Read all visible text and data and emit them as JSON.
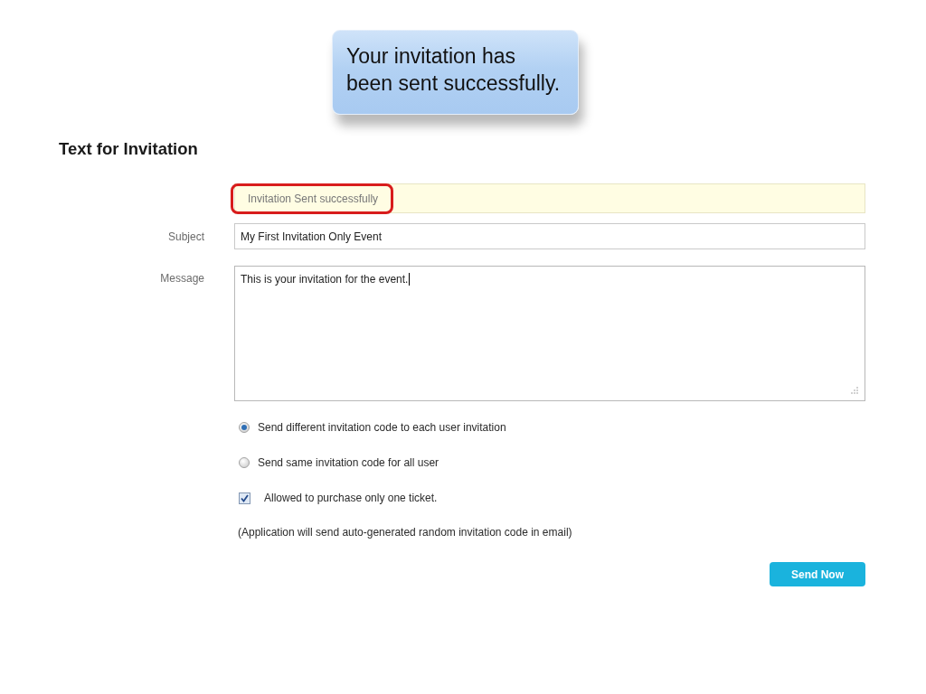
{
  "callout": {
    "text": "Your invitation has been sent successfully."
  },
  "heading": "Text for Invitation",
  "notice": {
    "text": "Invitation Sent successfully",
    "highlighted": true
  },
  "fields": [
    {
      "kind": "input",
      "label": "Subject",
      "value": "My First Invitation Only Event",
      "focused": false
    },
    {
      "kind": "textarea",
      "label": "Message",
      "value": "This is your invitation for the event.",
      "focused": true
    }
  ],
  "options": [
    {
      "kind": "radio",
      "label": "Send different invitation code to each user invitation",
      "selected": true
    },
    {
      "kind": "radio",
      "label": "Send same invitation code for all user",
      "selected": false
    },
    {
      "kind": "checkbox",
      "label": "Allowed to purchase only one ticket.",
      "checked": true
    }
  ],
  "note": "(Application will send auto-generated random invitation code in email)",
  "submit_button": {
    "label": "Send Now"
  }
}
